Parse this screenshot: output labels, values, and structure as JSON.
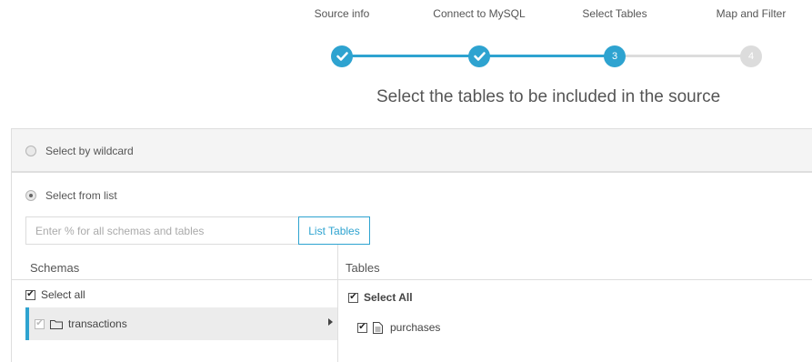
{
  "stepper": {
    "steps": [
      {
        "label": "Source info",
        "state": "done",
        "marker": "✓"
      },
      {
        "label": "Connect to MySQL",
        "state": "done",
        "marker": "✓"
      },
      {
        "label": "Select Tables",
        "state": "active",
        "marker": "3"
      },
      {
        "label": "Map and Filter",
        "state": "todo",
        "marker": "4"
      }
    ]
  },
  "heading": "Select the tables to be included in the source",
  "options": {
    "wildcard_label": "Select by wildcard",
    "list_label": "Select from list",
    "selected": "list"
  },
  "search": {
    "placeholder": "Enter % for all schemas and tables",
    "value": "",
    "button_label": "List Tables"
  },
  "schemas": {
    "header": "Schemas",
    "select_all_label": "Select all",
    "items": [
      {
        "name": "transactions",
        "checked": true,
        "selected": true
      }
    ]
  },
  "tables": {
    "header": "Tables",
    "select_all_label": "Select All",
    "items": [
      {
        "name": "purchases",
        "checked": true
      }
    ]
  },
  "colors": {
    "accent": "#2ea3d0",
    "inactive": "#dcdcdc"
  }
}
